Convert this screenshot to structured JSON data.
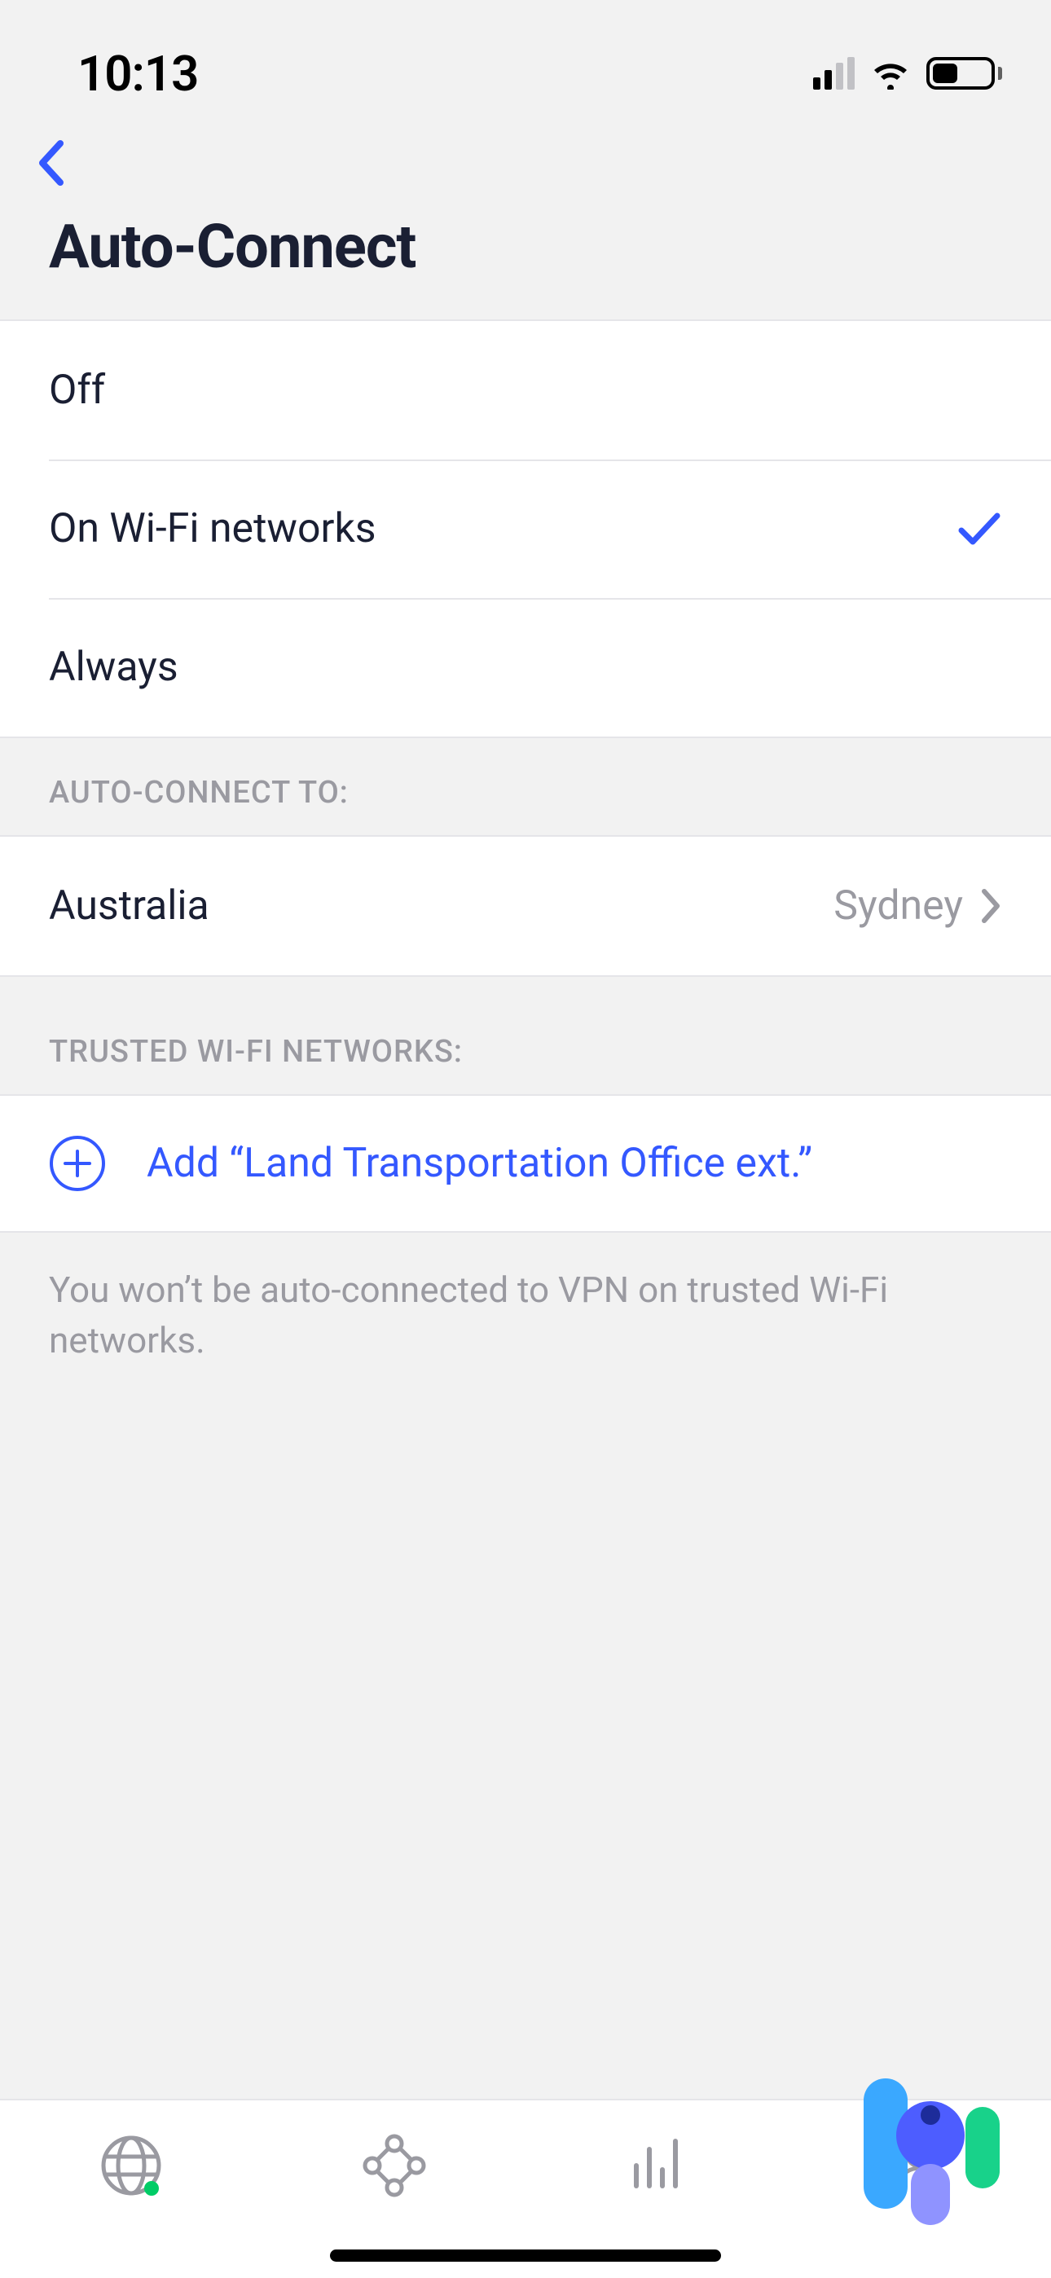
{
  "statusBar": {
    "time": "10:13"
  },
  "page": {
    "title": "Auto-Connect"
  },
  "options": [
    {
      "label": "Off",
      "selected": false
    },
    {
      "label": "On Wi-Fi networks",
      "selected": true
    },
    {
      "label": "Always",
      "selected": false
    }
  ],
  "sections": {
    "connectTo": {
      "header": "AUTO-CONNECT TO:",
      "row": {
        "label": "Australia",
        "value": "Sydney"
      }
    },
    "trusted": {
      "header": "TRUSTED WI-FI NETWORKS:",
      "addLabel": "Add “Land Transportation Office ext.”",
      "footerNote": "You won’t be auto-connected to VPN on trusted Wi-Fi networks."
    }
  },
  "colors": {
    "accent": "#3458ff"
  }
}
